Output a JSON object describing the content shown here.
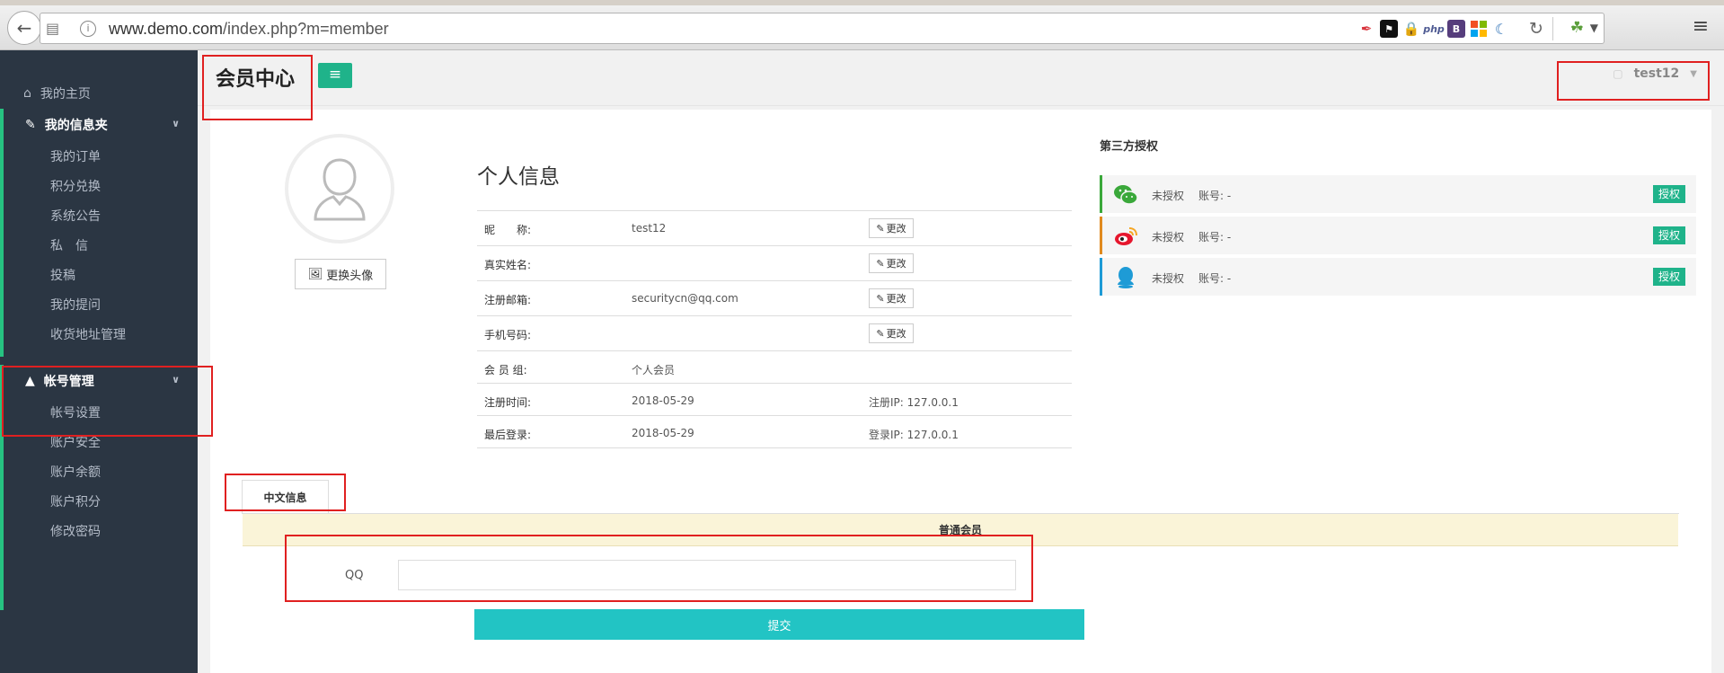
{
  "browser": {
    "url_host": "www.demo.com",
    "url_path": "/index.php?m=member",
    "extensions": [
      "feather-icon",
      "flag-icon",
      "lock-icon",
      "php-icon",
      "bootstrap-icon",
      "windows-icon",
      "wave-icon"
    ],
    "ext_php_label": "php",
    "ext_b_label": "B"
  },
  "sidebar": {
    "home": "我的主页",
    "group1": {
      "title": "我的信息夹",
      "items": [
        "我的订单",
        "积分兑换",
        "系统公告",
        "私　信",
        "投稿",
        "我的提问",
        "收货地址管理"
      ]
    },
    "group2": {
      "title": "帐号管理",
      "items": [
        "帐号设置",
        "账户安全",
        "账户余额",
        "账户积分",
        "修改密码"
      ]
    },
    "accent": "#26c281"
  },
  "header": {
    "title": "会员中心",
    "username": "test12"
  },
  "profile": {
    "change_avatar": "更换头像",
    "title": "个人信息",
    "edit_label": "更改",
    "rows": [
      {
        "label": "昵　　称:",
        "value": "test12"
      },
      {
        "label": "真实姓名:",
        "value": ""
      },
      {
        "label": "注册邮箱:",
        "value": "securitycn@qq.com"
      },
      {
        "label": "手机号码:",
        "value": ""
      },
      {
        "label": "会 员 组:",
        "value": "个人会员"
      },
      {
        "label": "注册时间:",
        "value": "2018-05-29",
        "extra": "注册IP: 127.0.0.1"
      },
      {
        "label": "最后登录:",
        "value": "2018-05-29",
        "extra": "登录IP: 127.0.0.1"
      }
    ]
  },
  "third_party": {
    "title": "第三方授权",
    "rows": [
      {
        "icon": "wechat-icon",
        "status": "未授权",
        "account": "账号: -",
        "button": "授权",
        "color": "#3aa83a"
      },
      {
        "icon": "weibo-icon",
        "status": "未授权",
        "account": "账号: -",
        "button": "授权",
        "color": "#e08a1f"
      },
      {
        "icon": "qq-icon",
        "status": "未授权",
        "account": "账号: -",
        "button": "授权",
        "color": "#1e9bd6"
      }
    ]
  },
  "form": {
    "tab": "中文信息",
    "section": "普通会员",
    "qq_label": "QQ",
    "qq_value": "",
    "submit": "提交"
  },
  "colors": {
    "primary_green": "#1fb38a",
    "submit_cyan": "#22c4c4",
    "sidebar_bg": "#2b3643",
    "highlight_red": "#e02020"
  }
}
